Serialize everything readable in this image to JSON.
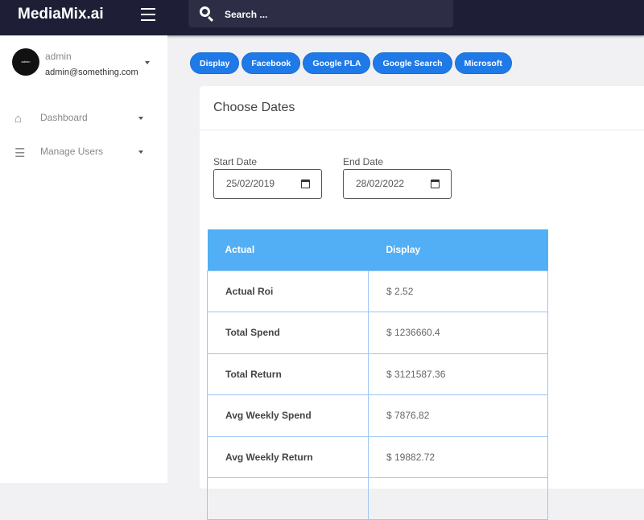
{
  "app": {
    "title": "MediaMix.ai"
  },
  "search": {
    "placeholder": "Search ..."
  },
  "user": {
    "avatar_text": "admin",
    "name": "admin",
    "email": "admin@something.com"
  },
  "sidebar": {
    "items": [
      {
        "label": "Dashboard",
        "icon": "home-icon"
      },
      {
        "label": "Manage Users",
        "icon": "layers-icon"
      }
    ]
  },
  "tabs": [
    "Display",
    "Facebook",
    "Google PLA",
    "Google Search",
    "Microsoft"
  ],
  "card": {
    "title": "Choose Dates",
    "start_label": "Start Date",
    "start_value": "25/02/2019",
    "end_label": "End Date",
    "end_value": "28/02/2022"
  },
  "table": {
    "headers": [
      "Actual",
      "Display"
    ],
    "rows": [
      [
        "Actual Roi",
        "$ 2.52"
      ],
      [
        "Total Spend",
        "$ 1236660.4"
      ],
      [
        "Total Return",
        "$ 3121587.36"
      ],
      [
        "Avg Weekly Spend",
        "$ 7876.82"
      ],
      [
        "Avg Weekly Return",
        "$ 19882.72"
      ]
    ]
  }
}
